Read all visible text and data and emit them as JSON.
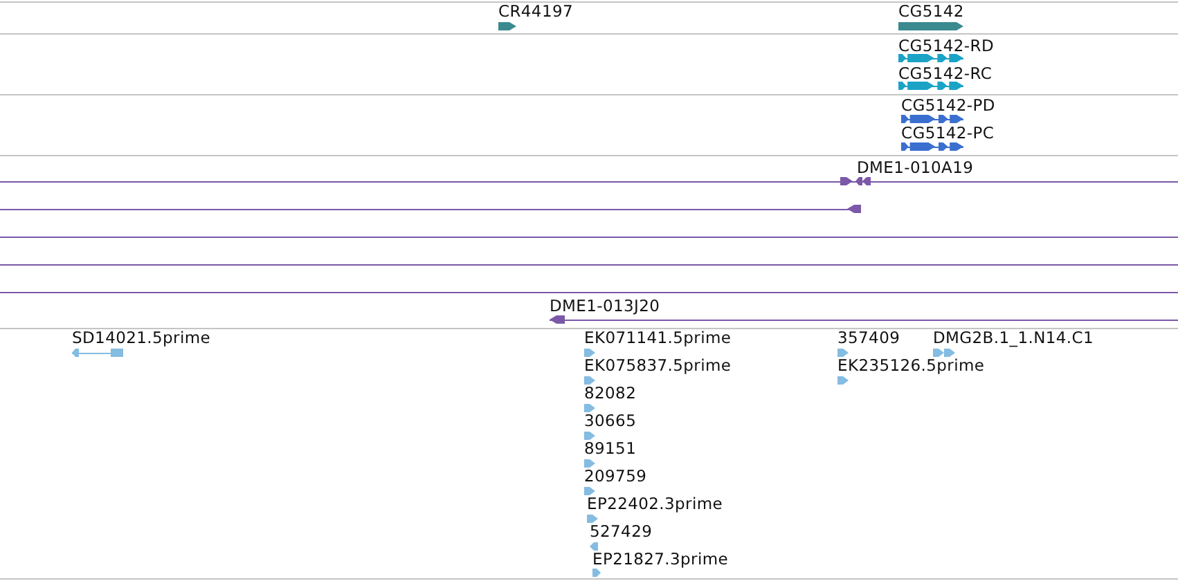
{
  "tracks": [
    {
      "kind": "gene",
      "color": "#3a8a8f",
      "features": [
        {
          "label": "CR44197",
          "reverse": false
        },
        {
          "label": "CG5142",
          "reverse": false
        }
      ]
    },
    {
      "kind": "transcript",
      "color": "#1ba3c6",
      "features": [
        {
          "label": "CG5142-RD",
          "reverse": false
        },
        {
          "label": "CG5142-RC",
          "reverse": false
        }
      ]
    },
    {
      "kind": "transcript",
      "color": "#3a6fd0",
      "features": [
        {
          "label": "CG5142-PD",
          "reverse": false
        },
        {
          "label": "CG5142-PC",
          "reverse": false
        }
      ]
    },
    {
      "kind": "clone",
      "color": "#7b58a8",
      "features": [
        {
          "kind": "end",
          "label": "DME1-010A19",
          "reverse": true
        },
        {
          "kind": "end",
          "reverse": true
        },
        {
          "kind": "line"
        },
        {
          "kind": "line"
        },
        {
          "kind": "line"
        },
        {
          "kind": "end",
          "label": "DME1-013J20",
          "reverse": true
        }
      ]
    },
    {
      "kind": "est",
      "color": "#84bce2",
      "features": [
        {
          "label": "SD14021.5prime",
          "reverse": true
        },
        {
          "label": "EK071141.5prime",
          "reverse": false
        },
        {
          "label": "EK075837.5prime",
          "reverse": false
        },
        {
          "label": "82082",
          "reverse": false
        },
        {
          "label": "30665",
          "reverse": false
        },
        {
          "label": "89151",
          "reverse": false
        },
        {
          "label": "209759",
          "reverse": false
        },
        {
          "label": "EP22402.3prime",
          "reverse": false
        },
        {
          "label": "527429",
          "reverse": true
        },
        {
          "label": "EP21827.3prime",
          "reverse": false
        },
        {
          "label": "357409",
          "reverse": false
        },
        {
          "label": "EK235126.5prime",
          "reverse": false
        },
        {
          "label": "DMG2B.1_1.N14.C1",
          "reverse": false
        }
      ]
    }
  ]
}
